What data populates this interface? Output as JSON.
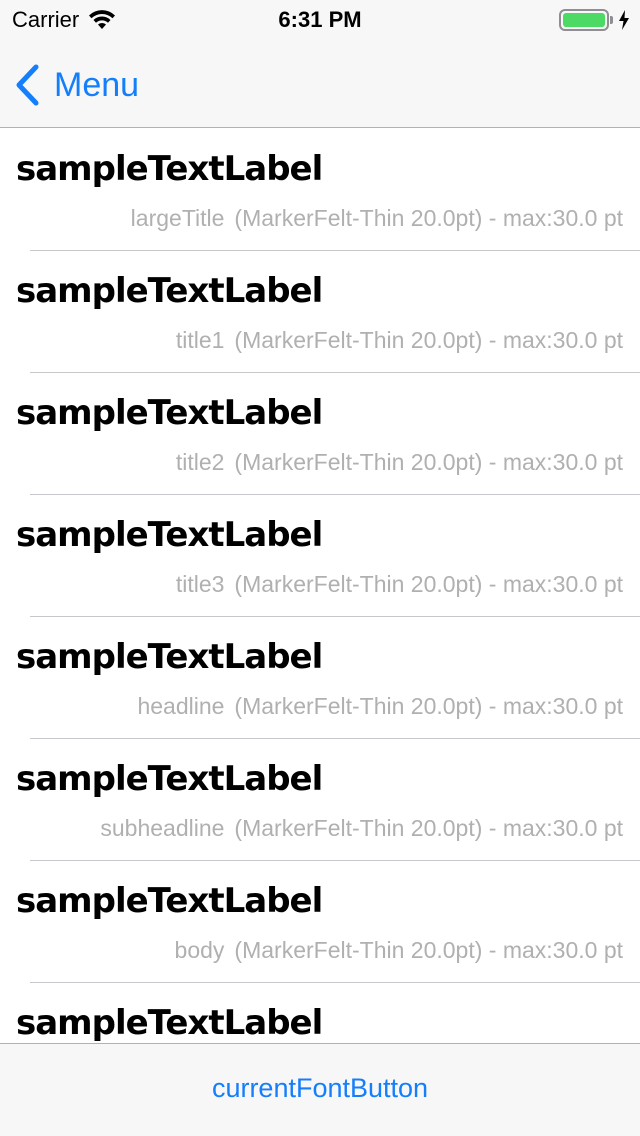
{
  "status_bar": {
    "carrier": "Carrier",
    "time": "6:31 PM",
    "icons": [
      "wifi-icon",
      "battery-icon",
      "charging-bolt-icon"
    ],
    "battery_color": "#4cd964"
  },
  "nav": {
    "back_label": "Menu",
    "back_icon": "chevron-left-icon",
    "tint_color": "#147efb"
  },
  "rows": [
    {
      "sample": "sampleTextLabel",
      "style": "largeTitle",
      "info": "(MarkerFelt-Thin 20.0pt) - max:30.0 pt"
    },
    {
      "sample": "sampleTextLabel",
      "style": "title1",
      "info": "(MarkerFelt-Thin 20.0pt) - max:30.0 pt"
    },
    {
      "sample": "sampleTextLabel",
      "style": "title2",
      "info": "(MarkerFelt-Thin 20.0pt) - max:30.0 pt"
    },
    {
      "sample": "sampleTextLabel",
      "style": "title3",
      "info": "(MarkerFelt-Thin 20.0pt) - max:30.0 pt"
    },
    {
      "sample": "sampleTextLabel",
      "style": "headline",
      "info": "(MarkerFelt-Thin 20.0pt) - max:30.0 pt"
    },
    {
      "sample": "sampleTextLabel",
      "style": "subheadline",
      "info": "(MarkerFelt-Thin 20.0pt) - max:30.0 pt"
    },
    {
      "sample": "sampleTextLabel",
      "style": "body",
      "info": "(MarkerFelt-Thin 20.0pt) - max:30.0 pt"
    },
    {
      "sample": "sampleTextLabel",
      "style": "",
      "info": ""
    }
  ],
  "toolbar": {
    "button_label": "currentFontButton"
  }
}
